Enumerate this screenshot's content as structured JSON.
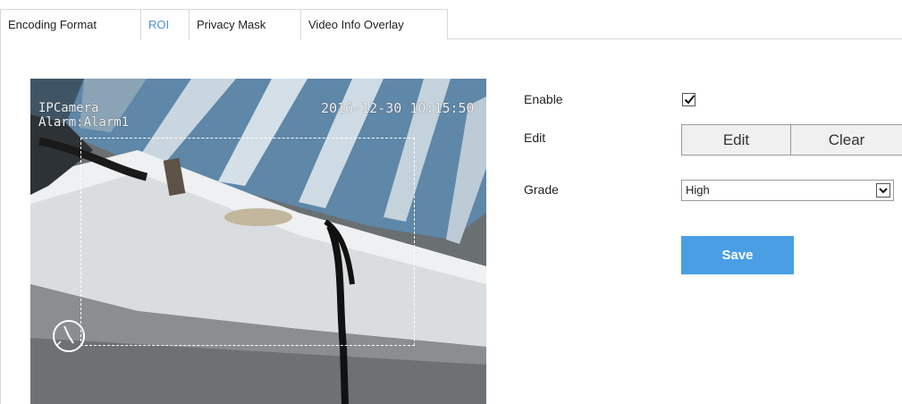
{
  "tabs": [
    {
      "label": "Encoding Format",
      "active": false
    },
    {
      "label": "ROI",
      "active": true
    },
    {
      "label": "Privacy Mask",
      "active": false
    },
    {
      "label": "Video Info Overlay",
      "active": false
    }
  ],
  "video": {
    "osd_name": "IPCamera",
    "osd_alarm": "Alarm:Alarm1",
    "osd_time": "2016-12-30 10:15:50"
  },
  "form": {
    "enable_label": "Enable",
    "enable_checked": true,
    "edit_label": "Edit",
    "edit_button": "Edit",
    "clear_button": "Clear",
    "grade_label": "Grade",
    "grade_value": "High",
    "save_button": "Save"
  },
  "colors": {
    "accent": "#4a9ee3",
    "active_tab_text": "#4a90d9"
  },
  "icons": {
    "checkbox": "checkmark-icon",
    "dropdown": "chevron-down-icon",
    "compass": "compass-icon"
  }
}
